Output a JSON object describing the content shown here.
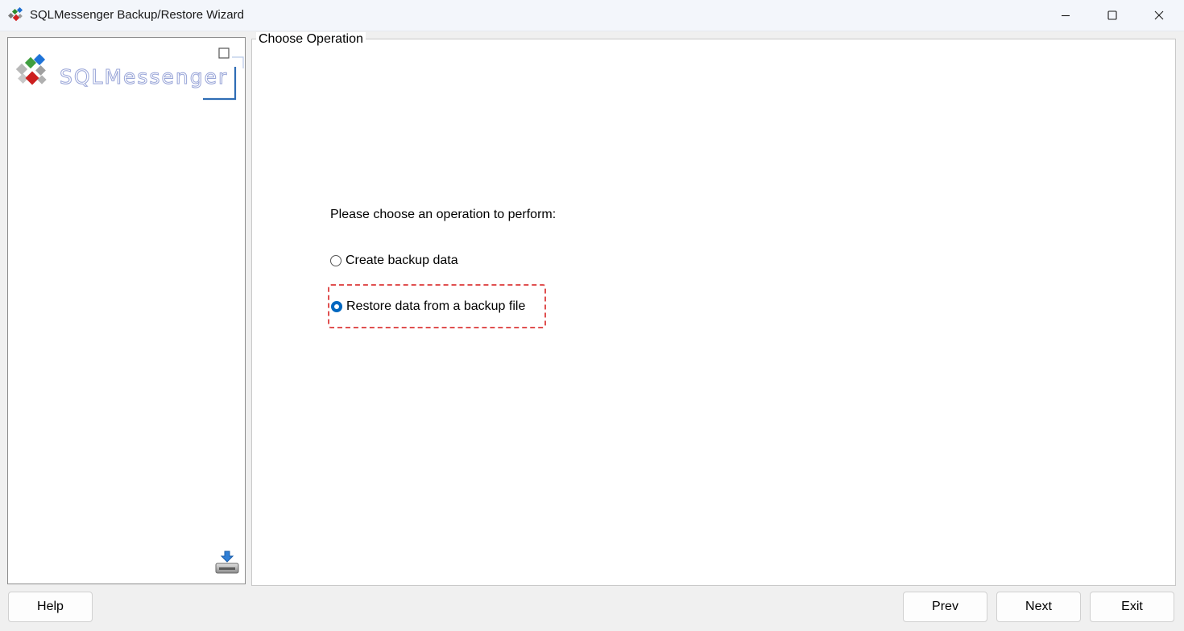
{
  "window": {
    "title": "SQLMessenger Backup/Restore Wizard",
    "controls": {
      "minimize": "minimize-icon",
      "maximize": "maximize-icon",
      "close": "close-icon"
    }
  },
  "sidebar": {
    "logo_text": "SQLMessenger",
    "bottom_icon": "download-tray-icon"
  },
  "main": {
    "group_title": "Choose Operation",
    "prompt": "Please choose an operation to perform:",
    "options": [
      {
        "label": "Create backup data",
        "checked": false
      },
      {
        "label": "Restore data from a backup file",
        "checked": true
      }
    ]
  },
  "footer": {
    "help_label": "Help",
    "prev_label": "Prev",
    "next_label": "Next",
    "exit_label": "Exit"
  },
  "colors": {
    "accent": "#0067c0",
    "focus_highlight": "#e05050"
  }
}
